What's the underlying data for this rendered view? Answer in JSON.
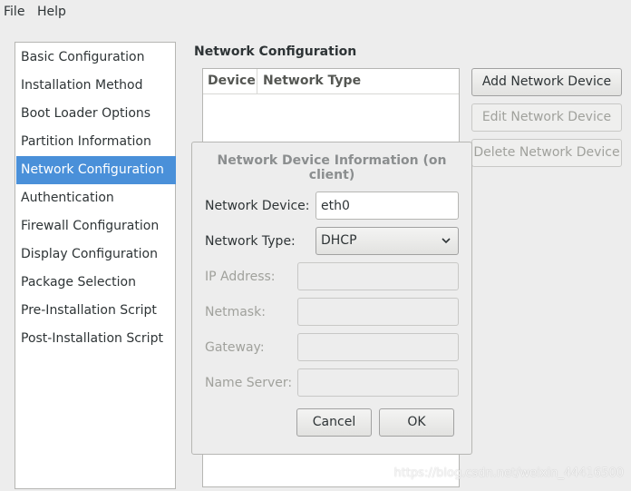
{
  "menubar": {
    "file": "File",
    "help": "Help"
  },
  "sidebar": {
    "items": [
      {
        "label": "Basic Configuration"
      },
      {
        "label": "Installation Method"
      },
      {
        "label": "Boot Loader Options"
      },
      {
        "label": "Partition Information"
      },
      {
        "label": "Network Configuration",
        "selected": true
      },
      {
        "label": "Authentication"
      },
      {
        "label": "Firewall Configuration"
      },
      {
        "label": "Display Configuration"
      },
      {
        "label": "Package Selection"
      },
      {
        "label": "Pre-Installation Script"
      },
      {
        "label": "Post-Installation Script"
      }
    ]
  },
  "main": {
    "title": "Network Configuration",
    "list": {
      "col_device": "Device",
      "col_type": "Network Type"
    },
    "buttons": {
      "add": "Add Network Device",
      "edit": "Edit Network Device",
      "delete": "Delete Network Device"
    }
  },
  "dialog": {
    "title": "Network Device Information (on client)",
    "network_device_label": "Network Device:",
    "network_device_value": "eth0",
    "network_type_label": "Network Type:",
    "network_type_value": "DHCP",
    "ip_label": "IP Address:",
    "netmask_label": "Netmask:",
    "gateway_label": "Gateway:",
    "nameserver_label": "Name Server:",
    "cancel": "Cancel",
    "ok": "OK"
  },
  "watermark": "https://blog.csdn.net/weixin_44416500",
  "colors": {
    "selection": "#4a90d9",
    "window_bg": "#ededed"
  },
  "icons": {
    "combo": "chevron-down-icon"
  }
}
